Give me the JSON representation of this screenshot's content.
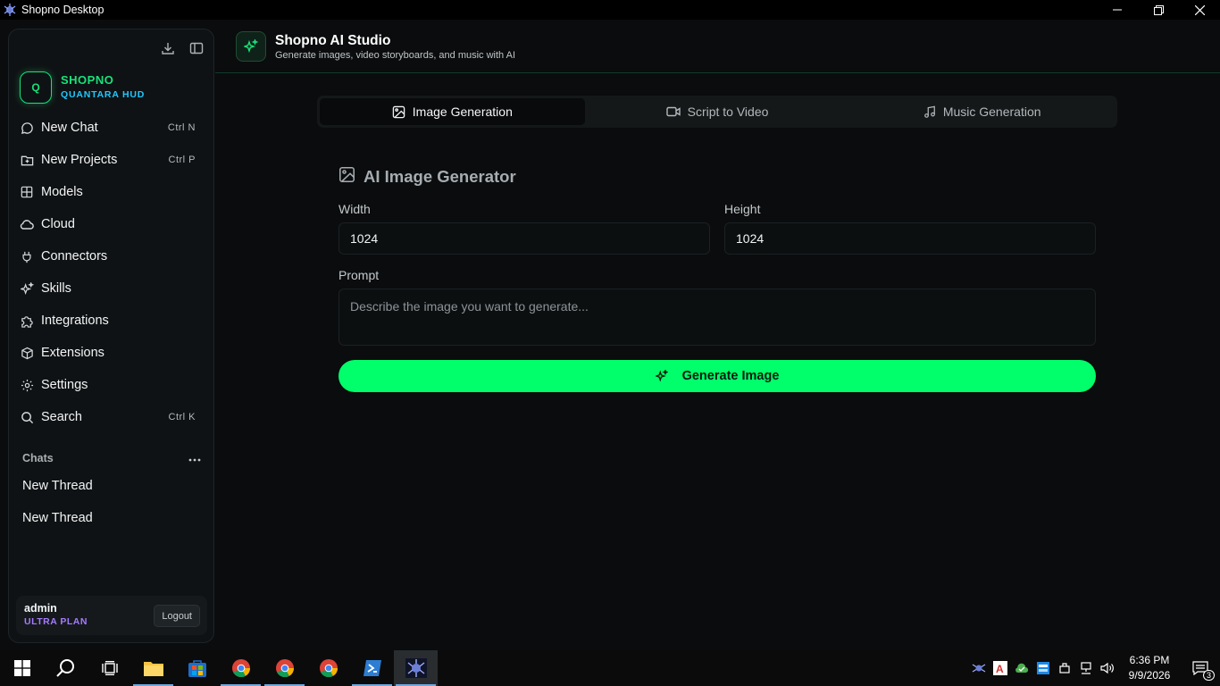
{
  "window": {
    "title": "Shopno Desktop"
  },
  "sidebar": {
    "brand": {
      "logo_letter": "Q",
      "name": "SHOPNO",
      "subtitle": "QUANTARA HUD"
    },
    "nav": [
      {
        "label": "New Chat",
        "shortcut": "Ctrl N",
        "icon": "chat-bubble-icon"
      },
      {
        "label": "New Projects",
        "shortcut": "Ctrl P",
        "icon": "folder-plus-icon"
      },
      {
        "label": "Models",
        "shortcut": "",
        "icon": "grid-icon"
      },
      {
        "label": "Cloud",
        "shortcut": "",
        "icon": "cloud-icon"
      },
      {
        "label": "Connectors",
        "shortcut": "",
        "icon": "plug-icon"
      },
      {
        "label": "Skills",
        "shortcut": "",
        "icon": "sparkles-icon"
      },
      {
        "label": "Integrations",
        "shortcut": "",
        "icon": "puzzle-icon"
      },
      {
        "label": "Extensions",
        "shortcut": "",
        "icon": "cube-icon"
      },
      {
        "label": "Settings",
        "shortcut": "",
        "icon": "gear-icon"
      },
      {
        "label": "Search",
        "shortcut": "Ctrl K",
        "icon": "search-icon"
      }
    ],
    "chats_label": "Chats",
    "threads": [
      "New Thread",
      "New Thread"
    ],
    "user": {
      "name": "admin",
      "plan": "ULTRA PLAN",
      "logout_label": "Logout"
    }
  },
  "header": {
    "title": "Shopno AI Studio",
    "subtitle": "Generate images, video storyboards, and music with AI"
  },
  "tabs": [
    {
      "label": "Image Generation",
      "active": true
    },
    {
      "label": "Script to Video",
      "active": false
    },
    {
      "label": "Music Generation",
      "active": false
    }
  ],
  "generator": {
    "title": "AI Image Generator",
    "width_label": "Width",
    "width_value": "1024",
    "height_label": "Height",
    "height_value": "1024",
    "prompt_label": "Prompt",
    "prompt_placeholder": "Describe the image you want to generate...",
    "button_label": "Generate Image"
  },
  "taskbar": {
    "clock_time": "6:36 PM",
    "clock_date": "9/9/2026",
    "notification_count": "3"
  },
  "colors": {
    "accent": "#00ff6a",
    "brand_green": "#19e27a",
    "brand_cyan": "#1fc8ff",
    "plan_purple": "#a57bff"
  }
}
